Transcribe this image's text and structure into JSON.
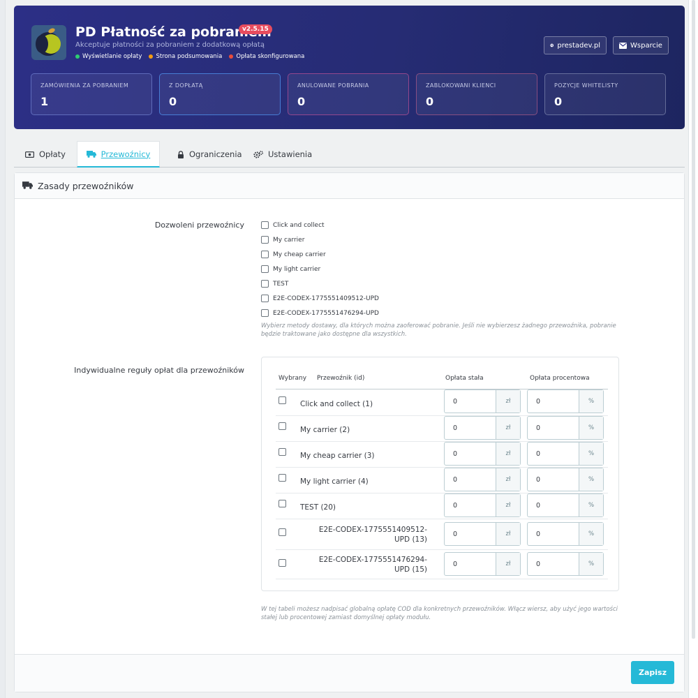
{
  "header": {
    "title": "PD Płatność za pobraniem",
    "version": "v2.5.15",
    "subtitle": "Akceptuje płatności za pobraniem z dodatkową opłatą",
    "statuses": [
      {
        "label": "Wyświetlanie opłaty",
        "color": "#2ecc71"
      },
      {
        "label": "Strona podsumowania",
        "color": "#f39c12"
      },
      {
        "label": "Opłata skonfigurowana",
        "color": "#e74c3c"
      }
    ],
    "site_link": "prestadev.pl",
    "support_link": "Wsparcie",
    "stats": [
      {
        "label": "ZAMÓWIENIA ZA POBRANIEM",
        "value": "1"
      },
      {
        "label": "Z DOPŁATĄ",
        "value": "0"
      },
      {
        "label": "ANULOWANE POBRANIA",
        "value": "0"
      },
      {
        "label": "ZABLOKOWANI KLIENCI",
        "value": "0"
      },
      {
        "label": "POZYCJE WHITELISTY",
        "value": "0"
      }
    ]
  },
  "tabs": [
    {
      "label": "Opłaty",
      "icon": "money-icon"
    },
    {
      "label": "Przewoźnicy",
      "icon": "truck-icon",
      "active": true
    },
    {
      "label": "Ograniczenia",
      "icon": "lock-icon"
    },
    {
      "label": "Ustawienia",
      "icon": "gears-icon"
    }
  ],
  "panel": {
    "title": "Zasady przewoźników",
    "allowed_label": "Dozwoleni przewoźnicy",
    "carriers": [
      "Click and collect",
      "My carrier",
      "My cheap carrier",
      "My light carrier",
      "TEST",
      "E2E-CODEX-1775551409512-UPD",
      "E2E-CODEX-1775551476294-UPD"
    ],
    "allowed_help": "Wybierz metody dostawy, dla których można zaoferować pobranie. Jeśli nie wybierzesz żadnego przewoźnika, pobranie będzie traktowane jako dostępne dla wszystkich.",
    "rules_label": "Indywidualne reguły opłat dla przewoźników",
    "table": {
      "headers": [
        "Wybrany",
        "Przewoźnik (id)",
        "Opłata stała",
        "Opłata procentowa"
      ],
      "currency_unit": "zł",
      "percent_unit": "%",
      "rows": [
        {
          "name": "Click and collect (1)",
          "fixed": "0",
          "percent": "0"
        },
        {
          "name": "My carrier (2)",
          "fixed": "0",
          "percent": "0"
        },
        {
          "name": "My cheap carrier (3)",
          "fixed": "0",
          "percent": "0"
        },
        {
          "name": "My light carrier (4)",
          "fixed": "0",
          "percent": "0"
        },
        {
          "name": "TEST (20)",
          "fixed": "0",
          "percent": "0"
        },
        {
          "name": "E2E-CODEX-1775551409512-UPD (13)",
          "fixed": "0",
          "percent": "0"
        },
        {
          "name": "E2E-CODEX-1775551476294-UPD (15)",
          "fixed": "0",
          "percent": "0"
        }
      ]
    },
    "rules_help": "W tej tabeli możesz nadpisać globalną opłatę COD dla konkretnych przewoźników. Włącz wiersz, aby użyć jego wartości stałej lub procentowej zamiast domyślnej opłaty modułu.",
    "save_label": "Zapisz"
  }
}
